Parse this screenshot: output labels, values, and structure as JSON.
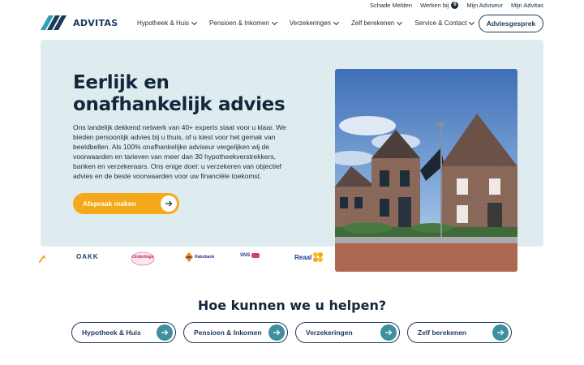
{
  "utility": {
    "schade": "Schade Melden",
    "werken": "Werken bij",
    "werken_badge": "6",
    "adviseur": "Mijn Adviseur",
    "advitas": "Mijn Advitas"
  },
  "brand": {
    "name": "ADVITAS"
  },
  "nav": {
    "items": [
      {
        "label": "Hypotheek & Huis"
      },
      {
        "label": "Pensioen & Inkomen"
      },
      {
        "label": "Verzekeringen"
      },
      {
        "label": "Zelf berekenen"
      },
      {
        "label": "Service & Contact"
      }
    ],
    "cta": "Adviesgesprek"
  },
  "hero": {
    "title": "Eerlijk en onafhankelijk advies",
    "text": "Ons landelijk dekkend netwerk van 40+ experts staat voor u klaar. We bieden persoonlijk advies bij u thuis, of u kiest voor het gemak van beeldbellen. Als 100% onafhankelijke adviseur vergelijken wij de voorwaarden en tarieven van meer dan 30 hypotheekverstrekkers, banken en verzekeraars. Ons enige doel: u verzekeren van objectief advies en de beste voorwaarden voor uw financiële toekomst.",
    "button": "Afspraak maken"
  },
  "partners": [
    {
      "name": "OAKK"
    },
    {
      "name": "Onderlinge"
    },
    {
      "name": "Rabobank"
    },
    {
      "name": "SNS"
    },
    {
      "name": "Reaal"
    }
  ],
  "help": {
    "title": "Hoe kunnen we u helpen?",
    "cards": [
      {
        "label": "Hypotheek & Huis"
      },
      {
        "label": "Pensioen & Inkomen"
      },
      {
        "label": "Verzekeringen"
      },
      {
        "label": "Zelf berekenen"
      }
    ]
  },
  "colors": {
    "primary": "#1c3a5c",
    "accent": "#f6a81b",
    "teal": "#3f8fa0",
    "hero_bg": "#dfecef"
  }
}
